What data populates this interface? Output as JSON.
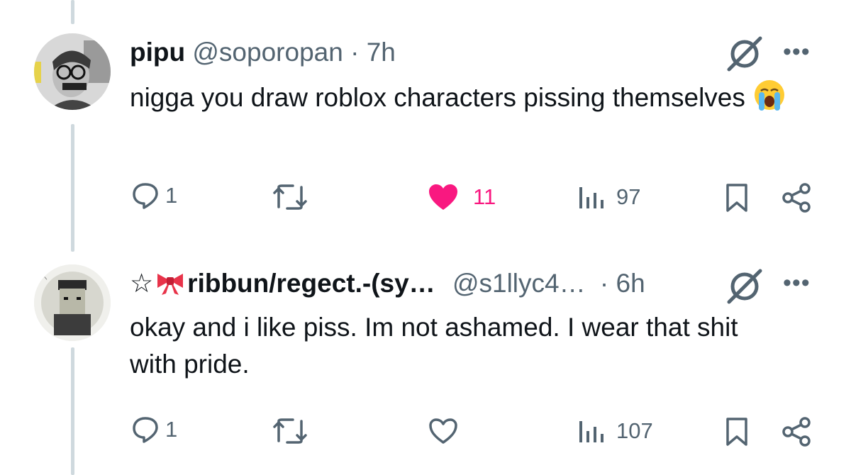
{
  "tweets": [
    {
      "name": "pipu",
      "handle": "@soporopan",
      "separator": "·",
      "time": "7h",
      "text": "nigga you draw roblox characters pissing themselves",
      "emoji": "loudly-crying-face",
      "replies": "1",
      "retweets": "",
      "likes": "11",
      "liked": true,
      "views": "97",
      "more": "•••"
    },
    {
      "name_prefix": "☆",
      "name_emoji": "ribbon",
      "name": "ribbun/regect.-(sy…",
      "handle": "@s1llyc4…",
      "separator": "·",
      "time": "6h",
      "text": "okay and i like piss. Im not ashamed. I wear that shit with pride.",
      "replies": "1",
      "retweets": "",
      "likes": "",
      "liked": false,
      "views": "107",
      "more": "•••"
    }
  ],
  "colors": {
    "text_primary": "#0f1419",
    "text_secondary": "#536471",
    "like_pink": "#f91880",
    "thread_line": "#cfd9de"
  }
}
